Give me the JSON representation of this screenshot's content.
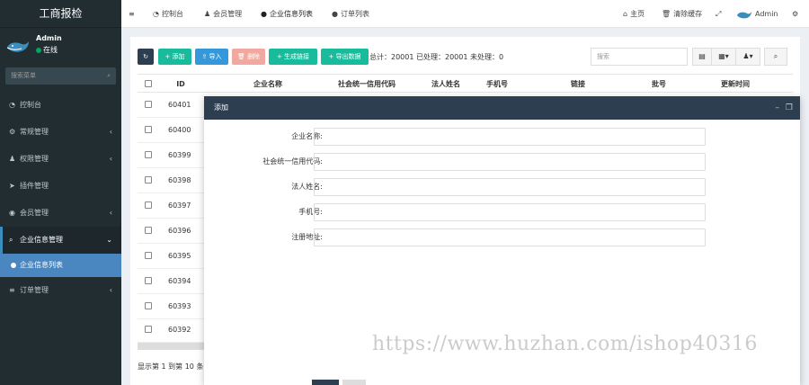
{
  "app": {
    "logo_title": "工商报检"
  },
  "user": {
    "name": "Admin",
    "status": "在线"
  },
  "sidebar": {
    "search_placeholder": "搜索菜单",
    "items": [
      {
        "icon": "dashboard-icon",
        "label": "控制台"
      },
      {
        "icon": "cogs-icon",
        "label": "常规管理"
      },
      {
        "icon": "group-icon",
        "label": "权限管理"
      },
      {
        "icon": "rocket-icon",
        "label": "插件管理"
      },
      {
        "icon": "user-circle-icon",
        "label": "会员管理"
      },
      {
        "icon": "search-icon",
        "label": "企业信息管理"
      },
      {
        "icon": "circle-icon",
        "label": "企业信息列表"
      },
      {
        "icon": "list-icon",
        "label": "订单管理"
      }
    ]
  },
  "topbar": {
    "tabs": [
      {
        "label": "控制台"
      },
      {
        "label": "会员管理"
      },
      {
        "label": "企业信息列表"
      },
      {
        "label": "订单列表"
      }
    ],
    "home": "主页",
    "clear_cache": "清除缓存",
    "admin": "Admin"
  },
  "toolbar": {
    "add": "添加",
    "import": "导入",
    "delete": "删除",
    "generate_link": "生成链接",
    "export": "导出数据",
    "summary": "总计：20001 已处理：20001 未处理：0",
    "search_placeholder": "搜索"
  },
  "table": {
    "headers": [
      "ID",
      "企业名称",
      "社会统一信用代码",
      "法人姓名",
      "手机号",
      "链接",
      "批号",
      "更新时间"
    ],
    "rows": [
      {
        "id": "60401"
      },
      {
        "id": "60400"
      },
      {
        "id": "60399"
      },
      {
        "id": "60398"
      },
      {
        "id": "60397"
      },
      {
        "id": "60396"
      },
      {
        "id": "60395"
      },
      {
        "id": "60394"
      },
      {
        "id": "60393"
      },
      {
        "id": "60392"
      }
    ],
    "footer": "显示第 1 到第 10 条"
  },
  "modal": {
    "title": "添加",
    "fields": [
      {
        "label": "企业名称:",
        "value": ""
      },
      {
        "label": "社会统一信用代码:",
        "value": ""
      },
      {
        "label": "法人姓名:",
        "value": ""
      },
      {
        "label": "手机号:",
        "value": ""
      },
      {
        "label": "注册地址:",
        "value": ""
      }
    ]
  },
  "watermark": "https://www.huzhan.com/ishop40316",
  "colors": {
    "sidebar_bg": "#222d32",
    "accent": "#3c8dbc",
    "green": "#18bc9c",
    "modal_head": "#2c3e50"
  }
}
